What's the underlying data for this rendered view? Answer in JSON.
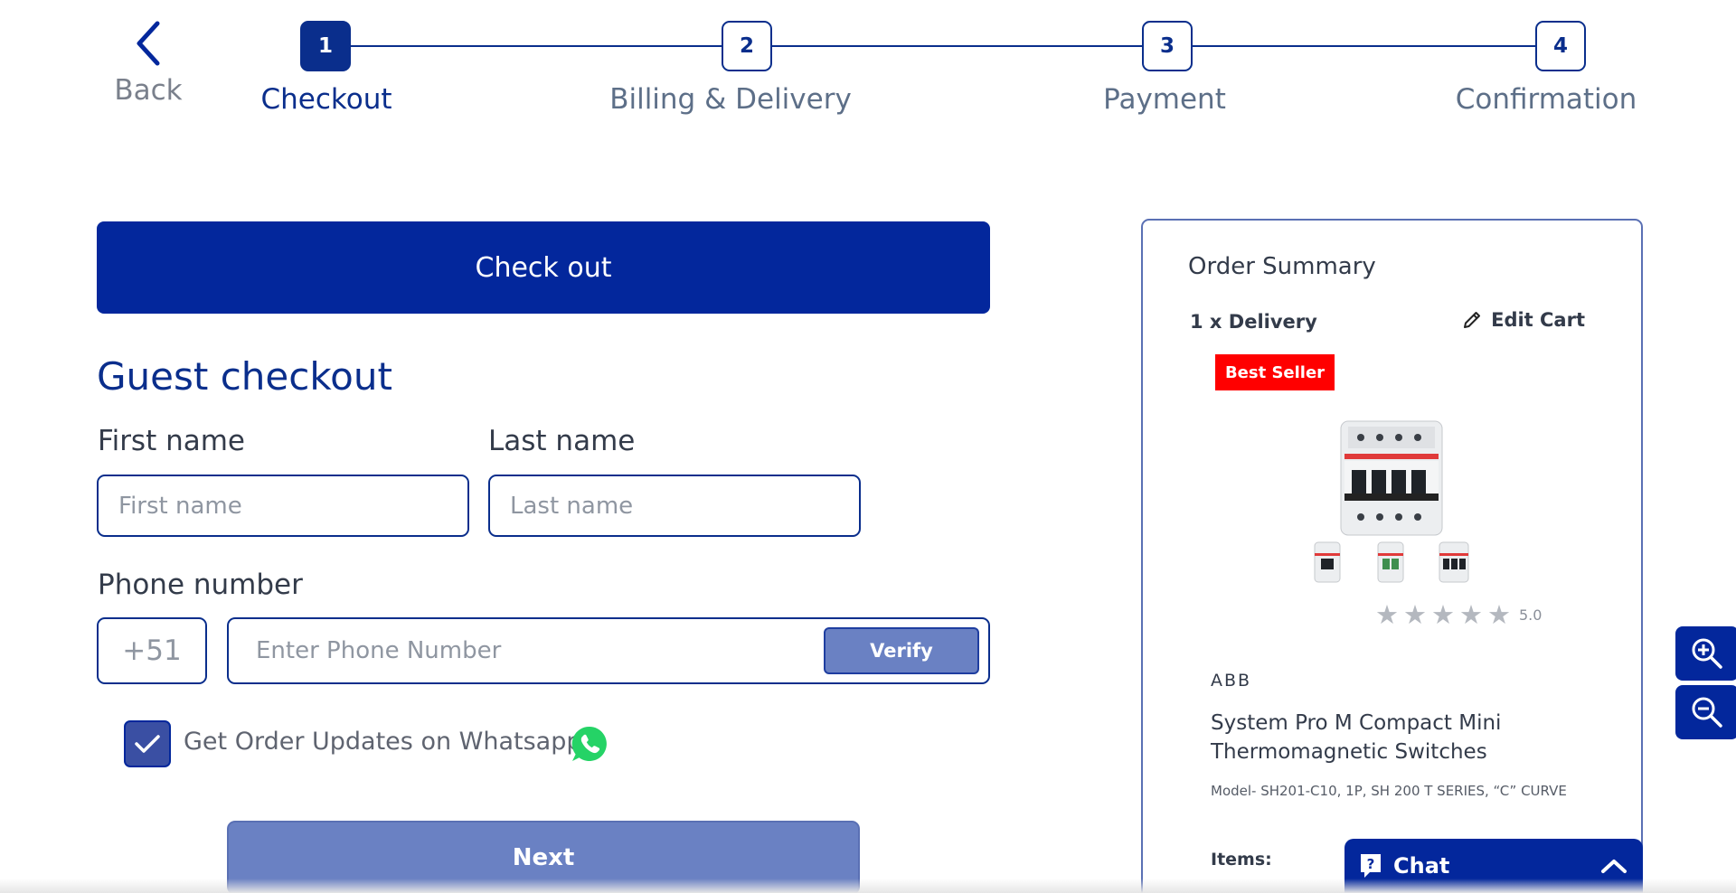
{
  "stepper": {
    "back_label": "Back",
    "steps": [
      {
        "number": "1",
        "label": "Checkout",
        "active": true
      },
      {
        "number": "2",
        "label": "Billing & Delivery",
        "active": false
      },
      {
        "number": "3",
        "label": "Payment",
        "active": false
      },
      {
        "number": "4",
        "label": "Confirmation",
        "active": false
      }
    ]
  },
  "form": {
    "checkout_banner": "Check out",
    "title": "Guest checkout",
    "first_name": {
      "label": "First name",
      "placeholder": "First name",
      "value": ""
    },
    "last_name": {
      "label": "Last name",
      "placeholder": "Last name",
      "value": ""
    },
    "phone": {
      "label": "Phone number",
      "country_code": "+51",
      "placeholder": "Enter Phone Number",
      "value": "",
      "verify_label": "Verify"
    },
    "whatsapp": {
      "label": "Get Order Updates on Whatsapp",
      "checked": true
    },
    "next_label": "Next"
  },
  "order_summary": {
    "title": "Order Summary",
    "delivery_count": "1 x Delivery",
    "edit_cart_label": "Edit Cart",
    "badge": "Best Seller",
    "rating": {
      "stars": 5,
      "value": "5.0"
    },
    "brand": "ABB",
    "product_name": "System Pro M Compact Mini Thermomagnetic Switches",
    "model": "Model- SH201-C10, 1P, SH 200 T SERIES, “C” CURVE",
    "items_label": "Items:"
  },
  "chat": {
    "label": "Chat"
  },
  "icons": {
    "back": "chevron-left-icon",
    "edit": "pencil-icon",
    "whatsapp": "whatsapp-icon",
    "check": "check-icon",
    "chat": "chat-question-icon",
    "chat_toggle": "chevron-up-icon",
    "zoom_in": "zoom-in-icon",
    "zoom_out": "zoom-out-icon"
  },
  "colors": {
    "primary": "#03279c",
    "primary_light": "#6a81c3",
    "badge_red": "#ff0000",
    "whatsapp_green": "#25d366",
    "step_inactive_text": "#5d6f88"
  }
}
